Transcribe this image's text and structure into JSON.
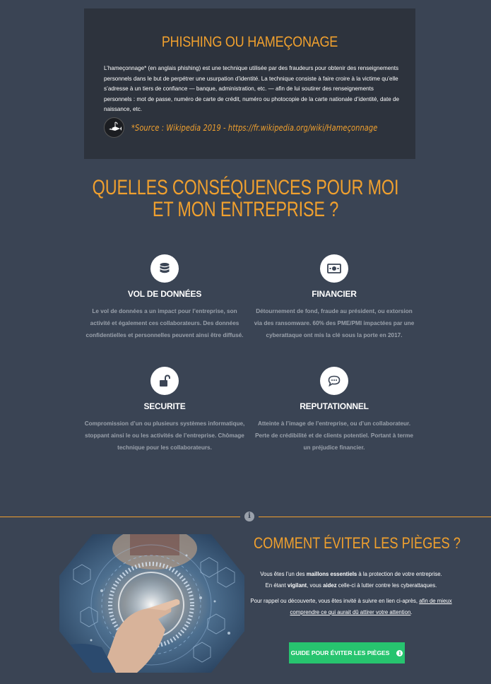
{
  "phishing": {
    "title": "PHISHING OU HAMEÇONAGE",
    "text": "L’hameçonnage* (en anglais phishing) est une technique utilisée par des fraudeurs pour obtenir des renseignements personnels dans le but de perpétrer une usurpation d’identité. La technique consiste à faire croire à la victime qu’elle s’adresse à un tiers de confiance — banque, administration, etc. — afin de lui soutirer des renseignements personnels : mot de passe, numéro de carte de crédit, numéro ou photocopie de la carte nationale d’identité, date de naissance, etc.",
    "source": "*Source : Wikipedia 2019 - https://fr.wikipedia.org/wiki/Hameçonnage",
    "avatar_icon": "fish-hook-icon"
  },
  "consequences": {
    "title_line1": "QUELLES CONSÉQUENCES POUR MOI",
    "title_line2": "ET MON ENTREPRISE ?",
    "items": [
      {
        "icon": "database-icon",
        "title": "VOL DE DONNÉES",
        "desc": "Le vol de données a un impact pour l’entreprise, son activité et également ces collaborateurs. Des données confidentielles et personnelles peuvent ainsi être diffusé."
      },
      {
        "icon": "money-bill-icon",
        "title": "FINANCIER",
        "desc": "Détournement de fond, fraude au président, ou extorsion via des ransomware. 60% des PME/PMI impactées par une cyberattaque ont mis la clé sous la porte en 2017."
      },
      {
        "icon": "unlock-icon",
        "title": "SECURITE",
        "desc": "Compromission d’un ou plusieurs systèmes informatique, stoppant ainsi le ou les activités de l’entreprise. Chômage technique pour les collaborateurs."
      },
      {
        "icon": "chat-bubble-icon",
        "title": "REPUTATIONNEL",
        "desc": "Atteinte à l’image de l’entreprise, ou d’un collaborateur. Perte de crédibilité et de clients potentiel. Portant à terme un préjudice financier."
      }
    ]
  },
  "pieges": {
    "title": "COMMENT ÉVITER LES PIÈGES ?",
    "p1_a": "Vous êtes l’un des ",
    "p1_b": "maillons essentiels",
    "p1_c": " à la protection de votre entreprise.",
    "p2_a": "En étant ",
    "p2_b": "vigilant",
    "p2_c": ", vous ",
    "p2_d": "aidez",
    "p2_e": " celle-ci à lutter contre les cyberattaques.",
    "p3_a": "Pour rappel ou découverte, vous êtes invité à suivre en lien ci-après, ",
    "p3_link": "afin de mieux comprendre ce qui aurait dû attirer votre attention",
    "p3_end": ".",
    "button_label": "GUIDE POUR ÉVITER LES PIÈGES",
    "button_icon": "info-icon",
    "divider_icon": "info-icon"
  },
  "colors": {
    "background": "#3a4454",
    "accent": "#f0a02e",
    "button": "#27c46f",
    "muted_text": "#9aa1ab"
  }
}
